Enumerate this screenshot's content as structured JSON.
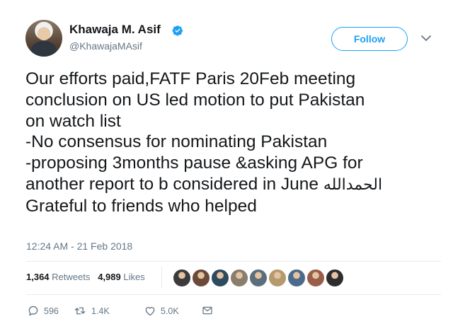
{
  "user": {
    "name": "Khawaja M. Asif",
    "handle": "@KhawajaMAsif"
  },
  "follow_label": "Follow",
  "tweet_lines": [
    "Our efforts paid,FATF Paris 20Feb meeting",
    "conclusion on US led motion to put Pakistan",
    "on watch list",
    "-No consensus for nominating Pakistan",
    "-proposing 3months pause &asking APG for",
    "another report to b considered in June",
    "Grateful to friends who helped"
  ],
  "tweet_arabic": "الحمدالله",
  "timestamp": "12:24 AM - 21 Feb 2018",
  "stats": {
    "retweets_count": "1,364",
    "retweets_label": "Retweets",
    "likes_count": "4,989",
    "likes_label": "Likes"
  },
  "actions": {
    "replies": "596",
    "retweets": "1.4K",
    "likes": "5.0K"
  },
  "likers": [
    "#3b3b3b",
    "#6b4a3a",
    "#2e4a5e",
    "#8a7d6b",
    "#5a6e7c",
    "#b49a6c",
    "#4b6b8a",
    "#9a5d4a",
    "#2d2d2d"
  ],
  "icons": {
    "verified": "verified-badge-icon",
    "caret": "chevron-down-icon",
    "reply": "reply-icon",
    "retweet": "retweet-icon",
    "like": "heart-icon",
    "dm": "envelope-icon"
  },
  "colors": {
    "accent": "#1da1f2",
    "muted": "#657786",
    "text": "#14171a"
  }
}
